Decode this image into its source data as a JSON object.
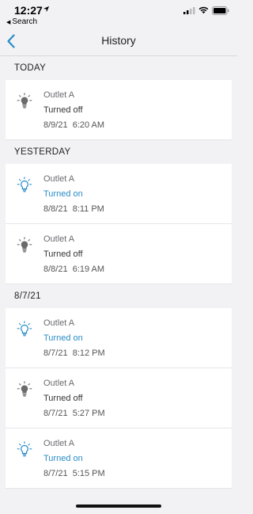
{
  "status_bar": {
    "time": "12:27",
    "back_app_label": "Search"
  },
  "nav": {
    "title": "History"
  },
  "sections": [
    {
      "header": "TODAY",
      "events": [
        {
          "device": "Outlet A",
          "state": "Turned off",
          "on": false,
          "date": "8/9/21",
          "time": "6:20 AM"
        }
      ]
    },
    {
      "header": "YESTERDAY",
      "events": [
        {
          "device": "Outlet A",
          "state": "Turned on",
          "on": true,
          "date": "8/8/21",
          "time": "8:11 PM"
        },
        {
          "device": "Outlet A",
          "state": "Turned off",
          "on": false,
          "date": "8/8/21",
          "time": "6:19 AM"
        }
      ]
    },
    {
      "header": "8/7/21",
      "events": [
        {
          "device": "Outlet A",
          "state": "Turned on",
          "on": true,
          "date": "8/7/21",
          "time": "8:12 PM"
        },
        {
          "device": "Outlet A",
          "state": "Turned off",
          "on": false,
          "date": "8/7/21",
          "time": "5:27 PM"
        },
        {
          "device": "Outlet A",
          "state": "Turned on",
          "on": true,
          "date": "8/7/21",
          "time": "5:15 PM"
        }
      ]
    }
  ],
  "colors": {
    "accent": "#2a8cc6",
    "bulb_off": "#6b6b6b",
    "background": "#f2f2f4"
  }
}
